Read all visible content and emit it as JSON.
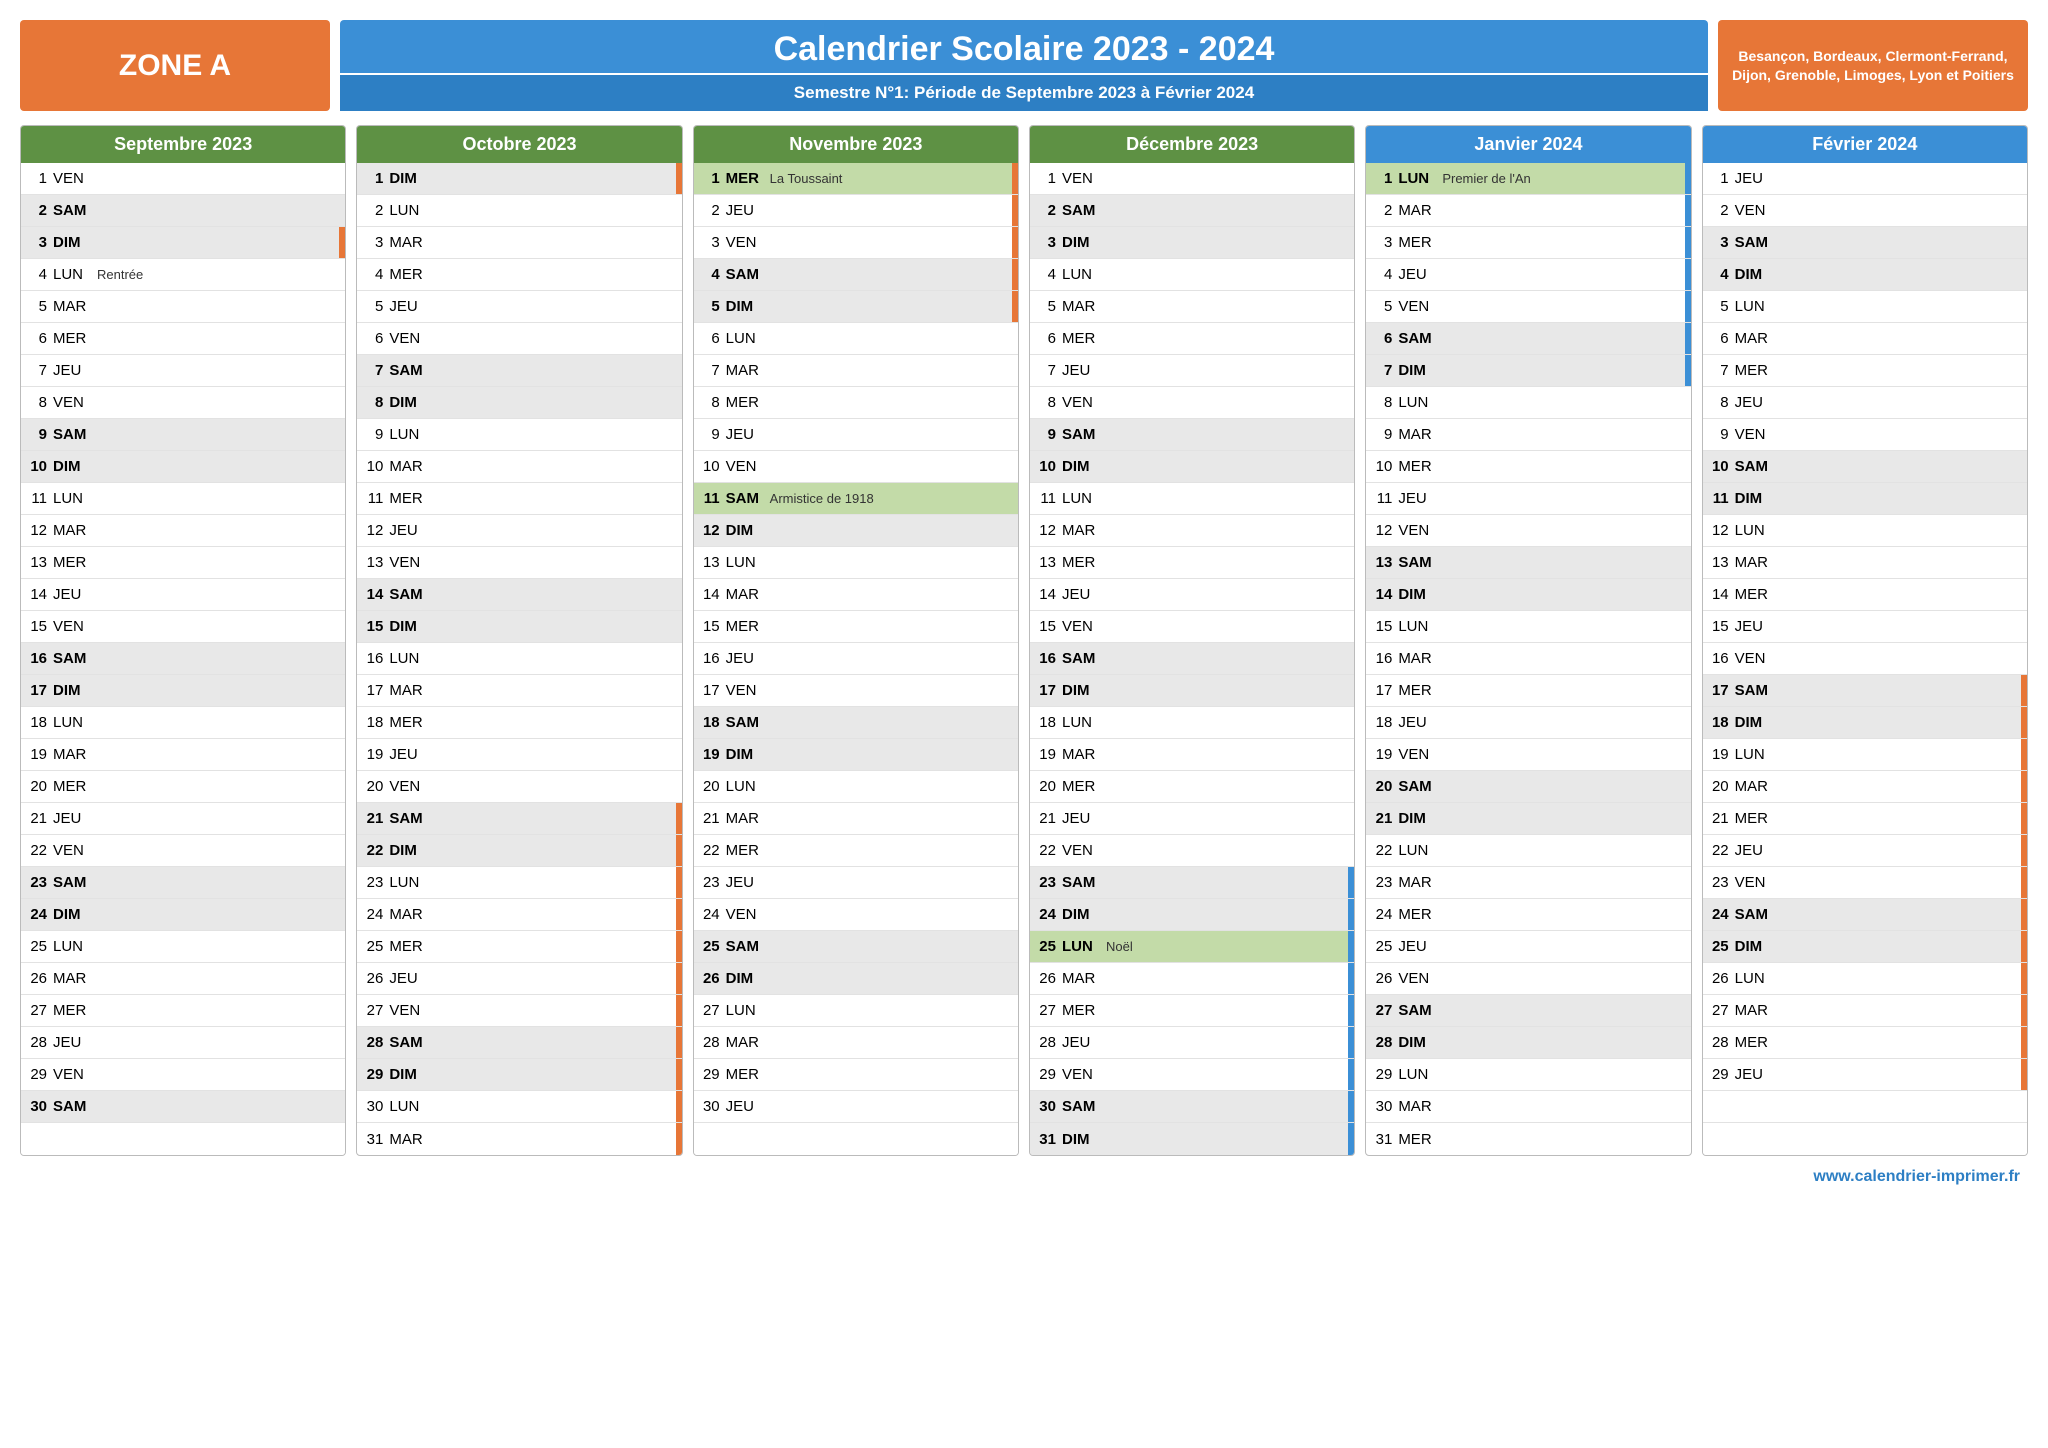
{
  "header": {
    "zone": "ZONE A",
    "title": "Calendrier Scolaire 2023 - 2024",
    "subtitle": "Semestre N°1: Période de Septembre 2023 à Février 2024",
    "cities": "Besançon, Bordeaux, Clermont-Ferrand, Dijon, Grenoble, Limoges, Lyon et Poitiers"
  },
  "footer": "www.calendrier-imprimer.fr",
  "months": [
    {
      "name": "Septembre 2023",
      "color": "green",
      "days": [
        {
          "n": 1,
          "d": "VEN"
        },
        {
          "n": 2,
          "d": "SAM",
          "w": true
        },
        {
          "n": 3,
          "d": "DIM",
          "w": true,
          "bar": "orange"
        },
        {
          "n": 4,
          "d": "LUN",
          "note": "Rentrée"
        },
        {
          "n": 5,
          "d": "MAR"
        },
        {
          "n": 6,
          "d": "MER"
        },
        {
          "n": 7,
          "d": "JEU"
        },
        {
          "n": 8,
          "d": "VEN"
        },
        {
          "n": 9,
          "d": "SAM",
          "w": true
        },
        {
          "n": 10,
          "d": "DIM",
          "w": true
        },
        {
          "n": 11,
          "d": "LUN"
        },
        {
          "n": 12,
          "d": "MAR"
        },
        {
          "n": 13,
          "d": "MER"
        },
        {
          "n": 14,
          "d": "JEU"
        },
        {
          "n": 15,
          "d": "VEN"
        },
        {
          "n": 16,
          "d": "SAM",
          "w": true
        },
        {
          "n": 17,
          "d": "DIM",
          "w": true
        },
        {
          "n": 18,
          "d": "LUN"
        },
        {
          "n": 19,
          "d": "MAR"
        },
        {
          "n": 20,
          "d": "MER"
        },
        {
          "n": 21,
          "d": "JEU"
        },
        {
          "n": 22,
          "d": "VEN"
        },
        {
          "n": 23,
          "d": "SAM",
          "w": true
        },
        {
          "n": 24,
          "d": "DIM",
          "w": true
        },
        {
          "n": 25,
          "d": "LUN"
        },
        {
          "n": 26,
          "d": "MAR"
        },
        {
          "n": 27,
          "d": "MER"
        },
        {
          "n": 28,
          "d": "JEU"
        },
        {
          "n": 29,
          "d": "VEN"
        },
        {
          "n": 30,
          "d": "SAM",
          "w": true
        },
        {
          "blank": true
        }
      ]
    },
    {
      "name": "Octobre 2023",
      "color": "green",
      "days": [
        {
          "n": 1,
          "d": "DIM",
          "w": true,
          "bar": "orange"
        },
        {
          "n": 2,
          "d": "LUN"
        },
        {
          "n": 3,
          "d": "MAR"
        },
        {
          "n": 4,
          "d": "MER"
        },
        {
          "n": 5,
          "d": "JEU"
        },
        {
          "n": 6,
          "d": "VEN"
        },
        {
          "n": 7,
          "d": "SAM",
          "w": true
        },
        {
          "n": 8,
          "d": "DIM",
          "w": true
        },
        {
          "n": 9,
          "d": "LUN"
        },
        {
          "n": 10,
          "d": "MAR"
        },
        {
          "n": 11,
          "d": "MER"
        },
        {
          "n": 12,
          "d": "JEU"
        },
        {
          "n": 13,
          "d": "VEN"
        },
        {
          "n": 14,
          "d": "SAM",
          "w": true
        },
        {
          "n": 15,
          "d": "DIM",
          "w": true
        },
        {
          "n": 16,
          "d": "LUN"
        },
        {
          "n": 17,
          "d": "MAR"
        },
        {
          "n": 18,
          "d": "MER"
        },
        {
          "n": 19,
          "d": "JEU"
        },
        {
          "n": 20,
          "d": "VEN"
        },
        {
          "n": 21,
          "d": "SAM",
          "w": true,
          "bar": "orange"
        },
        {
          "n": 22,
          "d": "DIM",
          "w": true,
          "bar": "orange"
        },
        {
          "n": 23,
          "d": "LUN",
          "bar": "orange"
        },
        {
          "n": 24,
          "d": "MAR",
          "bar": "orange"
        },
        {
          "n": 25,
          "d": "MER",
          "bar": "orange"
        },
        {
          "n": 26,
          "d": "JEU",
          "bar": "orange"
        },
        {
          "n": 27,
          "d": "VEN",
          "bar": "orange"
        },
        {
          "n": 28,
          "d": "SAM",
          "w": true,
          "bar": "orange"
        },
        {
          "n": 29,
          "d": "DIM",
          "w": true,
          "bar": "orange"
        },
        {
          "n": 30,
          "d": "LUN",
          "bar": "orange"
        },
        {
          "n": 31,
          "d": "MAR",
          "bar": "orange"
        }
      ]
    },
    {
      "name": "Novembre 2023",
      "color": "green",
      "days": [
        {
          "n": 1,
          "d": "MER",
          "h": true,
          "note": "La Toussaint",
          "bar": "orange"
        },
        {
          "n": 2,
          "d": "JEU",
          "bar": "orange"
        },
        {
          "n": 3,
          "d": "VEN",
          "bar": "orange"
        },
        {
          "n": 4,
          "d": "SAM",
          "w": true,
          "bar": "orange"
        },
        {
          "n": 5,
          "d": "DIM",
          "w": true,
          "bar": "orange"
        },
        {
          "n": 6,
          "d": "LUN"
        },
        {
          "n": 7,
          "d": "MAR"
        },
        {
          "n": 8,
          "d": "MER"
        },
        {
          "n": 9,
          "d": "JEU"
        },
        {
          "n": 10,
          "d": "VEN"
        },
        {
          "n": 11,
          "d": "SAM",
          "h": true,
          "note": "Armistice de 1918"
        },
        {
          "n": 12,
          "d": "DIM",
          "w": true
        },
        {
          "n": 13,
          "d": "LUN"
        },
        {
          "n": 14,
          "d": "MAR"
        },
        {
          "n": 15,
          "d": "MER"
        },
        {
          "n": 16,
          "d": "JEU"
        },
        {
          "n": 17,
          "d": "VEN"
        },
        {
          "n": 18,
          "d": "SAM",
          "w": true
        },
        {
          "n": 19,
          "d": "DIM",
          "w": true
        },
        {
          "n": 20,
          "d": "LUN"
        },
        {
          "n": 21,
          "d": "MAR"
        },
        {
          "n": 22,
          "d": "MER"
        },
        {
          "n": 23,
          "d": "JEU"
        },
        {
          "n": 24,
          "d": "VEN"
        },
        {
          "n": 25,
          "d": "SAM",
          "w": true
        },
        {
          "n": 26,
          "d": "DIM",
          "w": true
        },
        {
          "n": 27,
          "d": "LUN"
        },
        {
          "n": 28,
          "d": "MAR"
        },
        {
          "n": 29,
          "d": "MER"
        },
        {
          "n": 30,
          "d": "JEU"
        },
        {
          "blank": true
        }
      ]
    },
    {
      "name": "Décembre 2023",
      "color": "green",
      "days": [
        {
          "n": 1,
          "d": "VEN"
        },
        {
          "n": 2,
          "d": "SAM",
          "w": true
        },
        {
          "n": 3,
          "d": "DIM",
          "w": true
        },
        {
          "n": 4,
          "d": "LUN"
        },
        {
          "n": 5,
          "d": "MAR"
        },
        {
          "n": 6,
          "d": "MER"
        },
        {
          "n": 7,
          "d": "JEU"
        },
        {
          "n": 8,
          "d": "VEN"
        },
        {
          "n": 9,
          "d": "SAM",
          "w": true
        },
        {
          "n": 10,
          "d": "DIM",
          "w": true
        },
        {
          "n": 11,
          "d": "LUN"
        },
        {
          "n": 12,
          "d": "MAR"
        },
        {
          "n": 13,
          "d": "MER"
        },
        {
          "n": 14,
          "d": "JEU"
        },
        {
          "n": 15,
          "d": "VEN"
        },
        {
          "n": 16,
          "d": "SAM",
          "w": true
        },
        {
          "n": 17,
          "d": "DIM",
          "w": true
        },
        {
          "n": 18,
          "d": "LUN"
        },
        {
          "n": 19,
          "d": "MAR"
        },
        {
          "n": 20,
          "d": "MER"
        },
        {
          "n": 21,
          "d": "JEU"
        },
        {
          "n": 22,
          "d": "VEN"
        },
        {
          "n": 23,
          "d": "SAM",
          "w": true,
          "bar": "blue"
        },
        {
          "n": 24,
          "d": "DIM",
          "w": true,
          "bar": "blue"
        },
        {
          "n": 25,
          "d": "LUN",
          "h": true,
          "note": "Noël",
          "bar": "blue"
        },
        {
          "n": 26,
          "d": "MAR",
          "bar": "blue"
        },
        {
          "n": 27,
          "d": "MER",
          "bar": "blue"
        },
        {
          "n": 28,
          "d": "JEU",
          "bar": "blue"
        },
        {
          "n": 29,
          "d": "VEN",
          "bar": "blue"
        },
        {
          "n": 30,
          "d": "SAM",
          "w": true,
          "bar": "blue"
        },
        {
          "n": 31,
          "d": "DIM",
          "w": true,
          "bar": "blue"
        }
      ]
    },
    {
      "name": "Janvier 2024",
      "color": "blue",
      "days": [
        {
          "n": 1,
          "d": "LUN",
          "h": true,
          "note": "Premier de l'An",
          "bar": "blue"
        },
        {
          "n": 2,
          "d": "MAR",
          "bar": "blue"
        },
        {
          "n": 3,
          "d": "MER",
          "bar": "blue"
        },
        {
          "n": 4,
          "d": "JEU",
          "bar": "blue"
        },
        {
          "n": 5,
          "d": "VEN",
          "bar": "blue"
        },
        {
          "n": 6,
          "d": "SAM",
          "w": true,
          "bar": "blue"
        },
        {
          "n": 7,
          "d": "DIM",
          "w": true,
          "bar": "blue"
        },
        {
          "n": 8,
          "d": "LUN"
        },
        {
          "n": 9,
          "d": "MAR"
        },
        {
          "n": 10,
          "d": "MER"
        },
        {
          "n": 11,
          "d": "JEU"
        },
        {
          "n": 12,
          "d": "VEN"
        },
        {
          "n": 13,
          "d": "SAM",
          "w": true
        },
        {
          "n": 14,
          "d": "DIM",
          "w": true
        },
        {
          "n": 15,
          "d": "LUN"
        },
        {
          "n": 16,
          "d": "MAR"
        },
        {
          "n": 17,
          "d": "MER"
        },
        {
          "n": 18,
          "d": "JEU"
        },
        {
          "n": 19,
          "d": "VEN"
        },
        {
          "n": 20,
          "d": "SAM",
          "w": true
        },
        {
          "n": 21,
          "d": "DIM",
          "w": true
        },
        {
          "n": 22,
          "d": "LUN"
        },
        {
          "n": 23,
          "d": "MAR"
        },
        {
          "n": 24,
          "d": "MER"
        },
        {
          "n": 25,
          "d": "JEU"
        },
        {
          "n": 26,
          "d": "VEN"
        },
        {
          "n": 27,
          "d": "SAM",
          "w": true
        },
        {
          "n": 28,
          "d": "DIM",
          "w": true
        },
        {
          "n": 29,
          "d": "LUN"
        },
        {
          "n": 30,
          "d": "MAR"
        },
        {
          "n": 31,
          "d": "MER"
        }
      ]
    },
    {
      "name": "Février 2024",
      "color": "blue",
      "days": [
        {
          "n": 1,
          "d": "JEU"
        },
        {
          "n": 2,
          "d": "VEN"
        },
        {
          "n": 3,
          "d": "SAM",
          "w": true
        },
        {
          "n": 4,
          "d": "DIM",
          "w": true
        },
        {
          "n": 5,
          "d": "LUN"
        },
        {
          "n": 6,
          "d": "MAR"
        },
        {
          "n": 7,
          "d": "MER"
        },
        {
          "n": 8,
          "d": "JEU"
        },
        {
          "n": 9,
          "d": "VEN"
        },
        {
          "n": 10,
          "d": "SAM",
          "w": true
        },
        {
          "n": 11,
          "d": "DIM",
          "w": true
        },
        {
          "n": 12,
          "d": "LUN"
        },
        {
          "n": 13,
          "d": "MAR"
        },
        {
          "n": 14,
          "d": "MER"
        },
        {
          "n": 15,
          "d": "JEU"
        },
        {
          "n": 16,
          "d": "VEN"
        },
        {
          "n": 17,
          "d": "SAM",
          "w": true,
          "bar": "orange"
        },
        {
          "n": 18,
          "d": "DIM",
          "w": true,
          "bar": "orange"
        },
        {
          "n": 19,
          "d": "LUN",
          "bar": "orange"
        },
        {
          "n": 20,
          "d": "MAR",
          "bar": "orange"
        },
        {
          "n": 21,
          "d": "MER",
          "bar": "orange"
        },
        {
          "n": 22,
          "d": "JEU",
          "bar": "orange"
        },
        {
          "n": 23,
          "d": "VEN",
          "bar": "orange"
        },
        {
          "n": 24,
          "d": "SAM",
          "w": true,
          "bar": "orange"
        },
        {
          "n": 25,
          "d": "DIM",
          "w": true,
          "bar": "orange"
        },
        {
          "n": 26,
          "d": "LUN",
          "bar": "orange"
        },
        {
          "n": 27,
          "d": "MAR",
          "bar": "orange"
        },
        {
          "n": 28,
          "d": "MER",
          "bar": "orange"
        },
        {
          "n": 29,
          "d": "JEU",
          "bar": "orange"
        },
        {
          "blank": true
        },
        {
          "blank": true
        }
      ]
    }
  ]
}
